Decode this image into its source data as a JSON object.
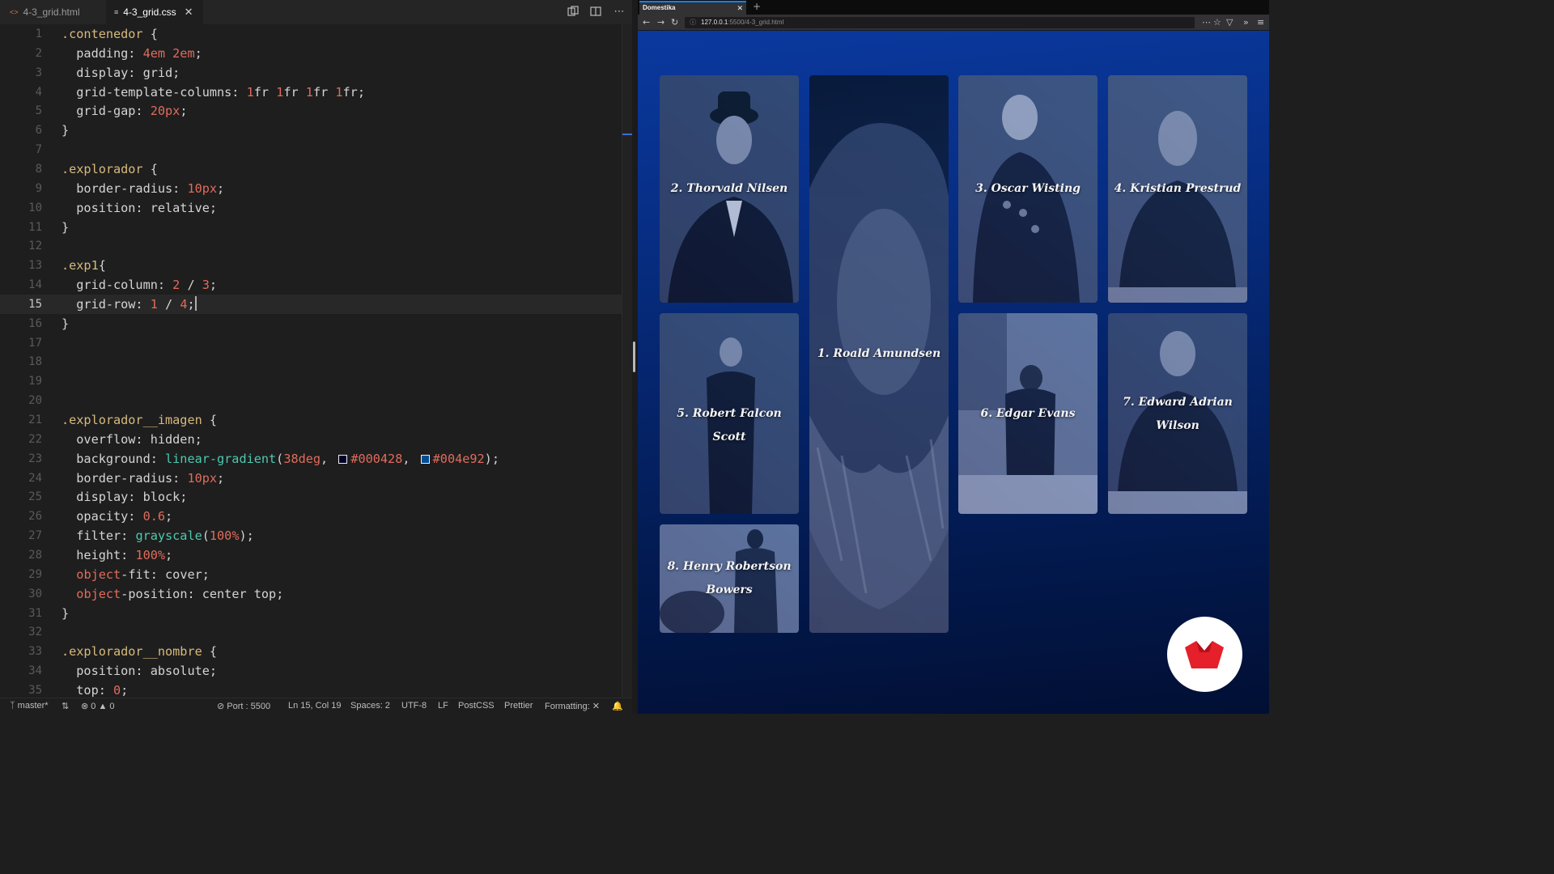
{
  "editor": {
    "tabs": [
      {
        "label": "4-3_grid.html",
        "icon": "html-file-icon"
      },
      {
        "label": "4-3_grid.css",
        "icon": "css-file-icon",
        "active": true
      }
    ],
    "active_line": 15,
    "lines": [
      {
        "n": "1",
        "t": [
          [
            ".contenedor",
            "sel"
          ],
          [
            " {",
            ""
          ]
        ]
      },
      {
        "n": "2",
        "t": [
          [
            "  padding: ",
            "prop"
          ],
          [
            "4em 2em",
            "num"
          ],
          [
            ";",
            ""
          ]
        ]
      },
      {
        "n": "3",
        "t": [
          [
            "  display: grid;",
            "prop"
          ]
        ]
      },
      {
        "n": "4",
        "t": [
          [
            "  grid-template-columns: ",
            "prop"
          ],
          [
            "1",
            "num"
          ],
          [
            "fr ",
            ""
          ],
          [
            "1",
            "num"
          ],
          [
            "fr ",
            ""
          ],
          [
            "1",
            "num"
          ],
          [
            "fr ",
            ""
          ],
          [
            "1",
            "num"
          ],
          [
            "fr;",
            ""
          ]
        ]
      },
      {
        "n": "5",
        "t": [
          [
            "  grid-gap: ",
            "prop"
          ],
          [
            "20px",
            "num"
          ],
          [
            ";",
            ""
          ]
        ]
      },
      {
        "n": "6",
        "t": [
          [
            "}",
            ""
          ]
        ]
      },
      {
        "n": "7",
        "t": []
      },
      {
        "n": "8",
        "t": [
          [
            ".explorador",
            "sel"
          ],
          [
            " {",
            ""
          ]
        ]
      },
      {
        "n": "9",
        "t": [
          [
            "  border-radius: ",
            "prop"
          ],
          [
            "10px",
            "num"
          ],
          [
            ";",
            ""
          ]
        ]
      },
      {
        "n": "10",
        "t": [
          [
            "  position: relative;",
            "prop"
          ]
        ]
      },
      {
        "n": "11",
        "t": [
          [
            "}",
            ""
          ]
        ]
      },
      {
        "n": "12",
        "t": []
      },
      {
        "n": "13",
        "t": [
          [
            ".exp1",
            "sel"
          ],
          [
            "{",
            ""
          ]
        ]
      },
      {
        "n": "14",
        "t": [
          [
            "  grid-column: ",
            "prop"
          ],
          [
            "2",
            "num"
          ],
          [
            " / ",
            ""
          ],
          [
            "3",
            "num"
          ],
          [
            ";",
            ""
          ]
        ]
      },
      {
        "n": "15",
        "t": [
          [
            "  grid-row: ",
            "prop"
          ],
          [
            "1",
            "num"
          ],
          [
            " / ",
            ""
          ],
          [
            "4",
            "num"
          ],
          [
            ";",
            ""
          ],
          [
            "",
            "cursor"
          ]
        ]
      },
      {
        "n": "16",
        "t": [
          [
            "}",
            ""
          ]
        ]
      },
      {
        "n": "17",
        "t": []
      },
      {
        "n": "18",
        "t": []
      },
      {
        "n": "19",
        "t": []
      },
      {
        "n": "20",
        "t": []
      },
      {
        "n": "21",
        "t": [
          [
            ".explorador__imagen",
            "sel"
          ],
          [
            " {",
            ""
          ]
        ]
      },
      {
        "n": "22",
        "t": [
          [
            "  overflow: hidden;",
            "prop"
          ]
        ]
      },
      {
        "n": "23",
        "t": [
          [
            "  background: ",
            "prop"
          ],
          [
            "linear-gradient",
            "fn"
          ],
          [
            "(",
            ""
          ],
          [
            "38deg",
            "num"
          ],
          [
            ", ",
            ""
          ],
          [
            "#000428",
            "swatch:#000428"
          ],
          [
            ", ",
            ""
          ],
          [
            "#004e92",
            "swatch:#004e92"
          ],
          [
            ");",
            ""
          ]
        ]
      },
      {
        "n": "24",
        "t": [
          [
            "  border-radius: ",
            "prop"
          ],
          [
            "10px",
            "num"
          ],
          [
            ";",
            ""
          ]
        ]
      },
      {
        "n": "25",
        "t": [
          [
            "  display: block;",
            "prop"
          ]
        ]
      },
      {
        "n": "26",
        "t": [
          [
            "  opacity: ",
            "prop"
          ],
          [
            "0.6",
            "num"
          ],
          [
            ";",
            ""
          ]
        ]
      },
      {
        "n": "27",
        "t": [
          [
            "  filter: ",
            "prop"
          ],
          [
            "grayscale",
            "fn"
          ],
          [
            "(",
            ""
          ],
          [
            "100%",
            "num"
          ],
          [
            ");",
            ""
          ]
        ]
      },
      {
        "n": "28",
        "t": [
          [
            "  height: ",
            "prop"
          ],
          [
            "100%",
            "num"
          ],
          [
            ";",
            ""
          ]
        ]
      },
      {
        "n": "29",
        "t": [
          [
            "  ",
            ""
          ],
          [
            "object",
            "kw"
          ],
          [
            "-fit: cover;",
            "prop"
          ]
        ]
      },
      {
        "n": "30",
        "t": [
          [
            "  ",
            ""
          ],
          [
            "object",
            "kw"
          ],
          [
            "-position: center top;",
            "prop"
          ]
        ]
      },
      {
        "n": "31",
        "t": [
          [
            "}",
            ""
          ]
        ]
      },
      {
        "n": "32",
        "t": []
      },
      {
        "n": "33",
        "t": [
          [
            ".explorador__nombre",
            "sel"
          ],
          [
            " {",
            ""
          ]
        ]
      },
      {
        "n": "34",
        "t": [
          [
            "  position: absolute;",
            "prop"
          ]
        ]
      },
      {
        "n": "35",
        "t": [
          [
            "  top: ",
            "prop"
          ],
          [
            "0",
            "num"
          ],
          [
            ";",
            ""
          ]
        ]
      }
    ],
    "status": {
      "branch": "master*",
      "errors": "0",
      "warnings": "0",
      "port": "Port : 5500",
      "position": "Ln 15, Col 19",
      "spaces": "Spaces: 2",
      "encoding": "UTF-8",
      "eol": "LF",
      "language": "PostCSS",
      "formatter": "Prettier",
      "formatting": "Formatting:"
    }
  },
  "browser": {
    "tab_title": "Domestika",
    "url_host": "127.0.0.1",
    "url_path": ":5500/4-3_grid.html",
    "explorers": [
      {
        "name": "1. Roald Amundsen"
      },
      {
        "name": "2. Thorvald Nilsen"
      },
      {
        "name": "3. Oscar Wisting"
      },
      {
        "name": "4. Kristian Prestrud"
      },
      {
        "name": "5. Robert Falcon Scott"
      },
      {
        "name": "6. Edgar Evans"
      },
      {
        "name": "7. Edward Adrian Wilson"
      },
      {
        "name": "8. Henry Robertson Bowers"
      }
    ],
    "logo": "domestika-logo",
    "gradient_colors": [
      "#000428",
      "#004e92"
    ]
  }
}
